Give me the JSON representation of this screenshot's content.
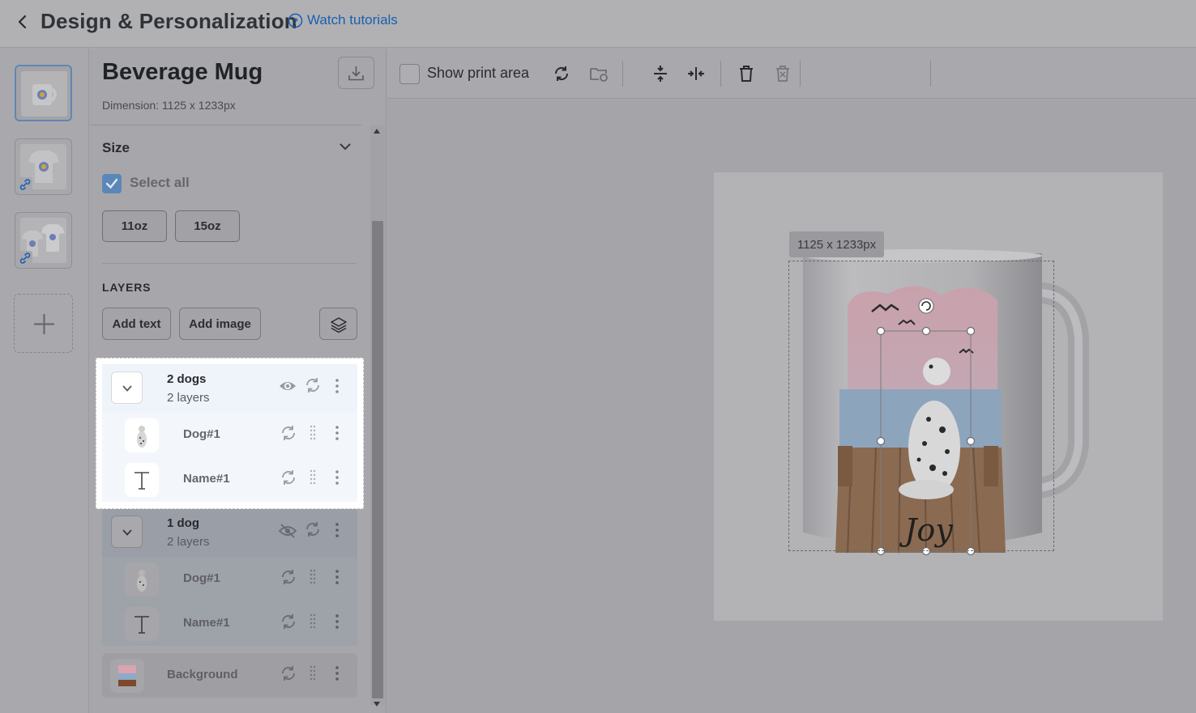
{
  "header": {
    "title": "Design & Personalization",
    "tutorial_label": "Watch tutorials"
  },
  "thumbnails": [
    {
      "name": "mug",
      "active": true,
      "linked": false
    },
    {
      "name": "tshirt",
      "active": false,
      "linked": true
    },
    {
      "name": "tshirt-pair",
      "active": false,
      "linked": true
    }
  ],
  "panel": {
    "title": "Beverage Mug",
    "dimension": "Dimension: 1125 x 1233px",
    "size_label": "Size",
    "select_all_label": "Select all",
    "select_all_checked": true,
    "sizes": [
      "11oz",
      "15oz"
    ],
    "layers_heading": "LAYERS",
    "add_text_label": "Add text",
    "add_image_label": "Add image"
  },
  "layer_groups": [
    {
      "name": "2 dogs",
      "count": "2 layers",
      "visible": true,
      "children": [
        {
          "name": "Dog#1",
          "type": "image"
        },
        {
          "name": "Name#1",
          "type": "text"
        }
      ]
    },
    {
      "name": "1 dog",
      "count": "2 layers",
      "visible": false,
      "children": [
        {
          "name": "Dog#1",
          "type": "image"
        },
        {
          "name": "Name#1",
          "type": "text"
        }
      ]
    }
  ],
  "background_layer": {
    "name": "Background"
  },
  "toolbar": {
    "show_print_area_label": "Show print area",
    "show_print_area_checked": false
  },
  "canvas": {
    "dimension_badge": "1125 x 1233px",
    "mug_text": "Joy"
  },
  "colors": {
    "accent": "#1b5fb0",
    "overlay": "#a9a9ad",
    "highlight": "#ffffff"
  }
}
